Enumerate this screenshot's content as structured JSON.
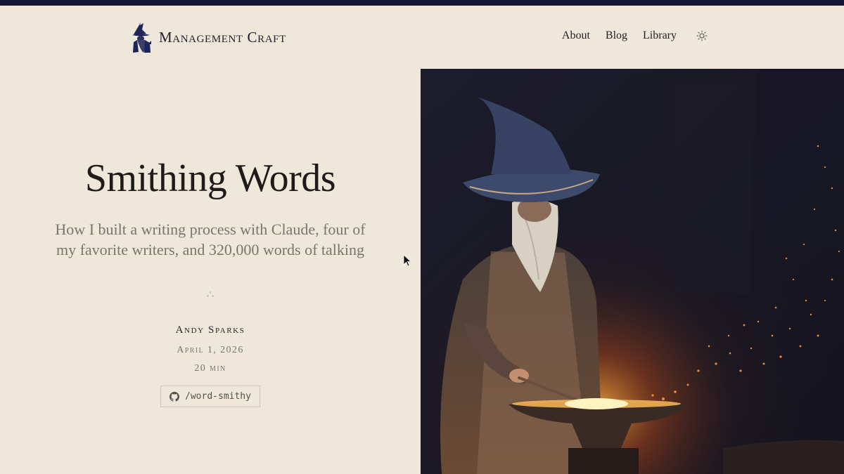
{
  "site": {
    "name": "Management Craft",
    "logo_icon": "wizard-logo-icon"
  },
  "nav": {
    "items": [
      {
        "label": "About"
      },
      {
        "label": "Blog"
      },
      {
        "label": "Library"
      }
    ],
    "theme_icon": "sun-icon"
  },
  "article": {
    "title": "Smithing Words",
    "subtitle": "How I built a writing process with Claude, four of my favorite writers, and 320,000 words of talking",
    "author": "Andy Sparks",
    "date": "April 1, 2026",
    "read_time": "20 min",
    "repo_label": "/word-smithy",
    "repo_icon": "github-icon"
  },
  "hero_image": {
    "subject": "wizard-blacksmith-at-anvil"
  },
  "colors": {
    "background": "#efe7da",
    "topbar": "#131633",
    "text": "#1e1b1a",
    "muted": "#7a7470"
  }
}
